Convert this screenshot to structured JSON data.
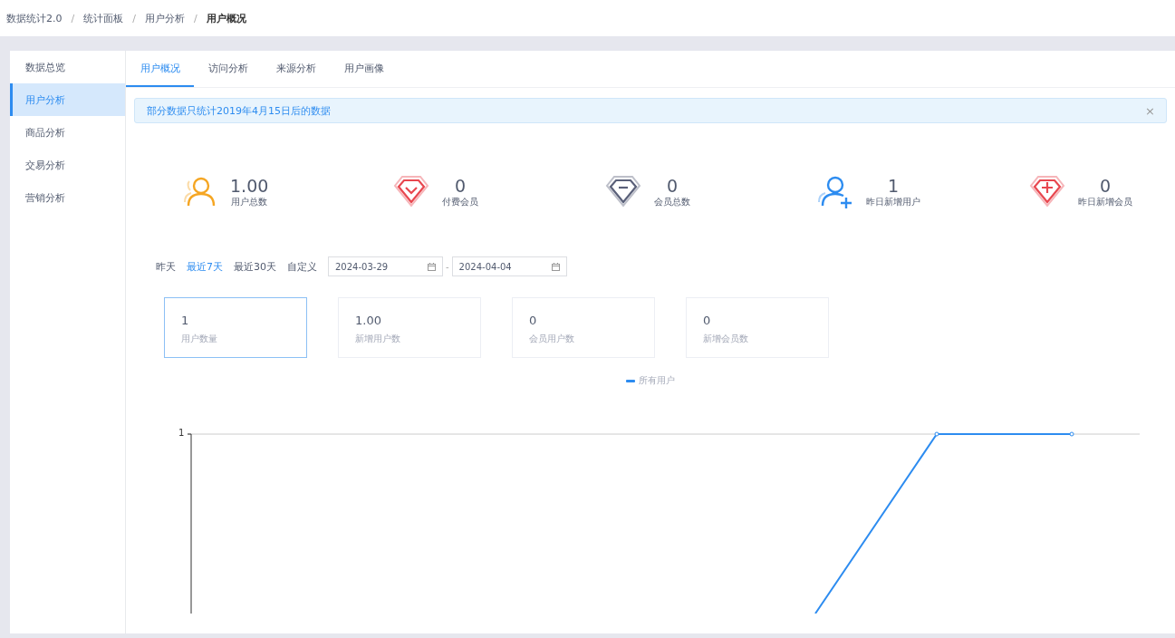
{
  "breadcrumb_separator": "/",
  "breadcrumb": [
    {
      "label": "数据统计2.0",
      "current": false
    },
    {
      "label": "统计面板",
      "current": false
    },
    {
      "label": "用户分析",
      "current": false
    },
    {
      "label": "用户概况",
      "current": true
    }
  ],
  "sidebar": {
    "items": [
      {
        "label": "数据总览",
        "selected": false
      },
      {
        "label": "用户分析",
        "selected": true
      },
      {
        "label": "商品分析",
        "selected": false
      },
      {
        "label": "交易分析",
        "selected": false
      },
      {
        "label": "营销分析",
        "selected": false
      }
    ]
  },
  "tabs": [
    {
      "label": "用户概况",
      "selected": true
    },
    {
      "label": "访问分析",
      "selected": false
    },
    {
      "label": "来源分析",
      "selected": false
    },
    {
      "label": "用户画像",
      "selected": false
    }
  ],
  "alert": {
    "text": "部分数据只统计2019年4月15日后的数据",
    "close": "×"
  },
  "stats": [
    {
      "kind": "user",
      "value": "1.00",
      "label": "用户总数"
    },
    {
      "kind": "diamond-check",
      "value": "0",
      "label": "付费会员"
    },
    {
      "kind": "diamond-minus",
      "value": "0",
      "label": "会员总数"
    },
    {
      "kind": "user-plus",
      "value": "1",
      "label": "昨日新增用户"
    },
    {
      "kind": "diamond-plus",
      "value": "0",
      "label": "昨日新增会员"
    }
  ],
  "range": {
    "options": [
      {
        "label": "昨天",
        "selected": false
      },
      {
        "label": "最近7天",
        "selected": true
      },
      {
        "label": "最近30天",
        "selected": false
      },
      {
        "label": "自定义",
        "selected": false
      }
    ],
    "start": "2024-03-29",
    "separator": "-",
    "end": "2024-04-04"
  },
  "metric_cards": [
    {
      "value": "1",
      "label": "用户数量",
      "selected": true
    },
    {
      "value": "1.00",
      "label": "新增用户数",
      "selected": false
    },
    {
      "value": "0",
      "label": "会员用户数",
      "selected": false
    },
    {
      "value": "0",
      "label": "新增会员数",
      "selected": false
    }
  ],
  "chart": {
    "legend": "所有用户",
    "y_tick": "1"
  }
}
